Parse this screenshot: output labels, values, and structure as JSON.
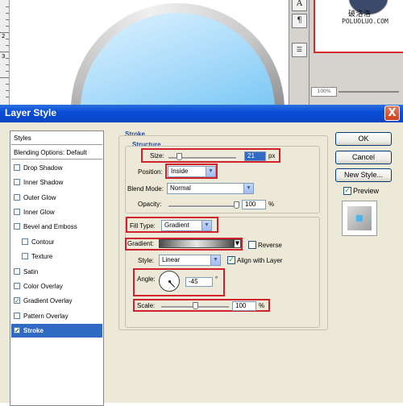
{
  "background": {
    "ruler_numbers": [
      "2",
      "3"
    ],
    "tool_icons": [
      "text-tool-icon",
      "paragraph-icon",
      "panel-menu-icon"
    ],
    "tool_glyphs": [
      "A",
      "¶",
      "☰"
    ],
    "navigator": {
      "logo_text": "破洛洛",
      "url_text": "POLUOLUO.COM",
      "zoom": "100%"
    }
  },
  "dialog": {
    "title": "Layer Style",
    "close_label": "X",
    "styles_list": [
      {
        "label": "Styles",
        "checkbox": false,
        "checked": false,
        "header": true
      },
      {
        "label": "Blending Options: Default",
        "checkbox": false,
        "checked": false,
        "header": true
      },
      {
        "label": "Drop Shadow",
        "checkbox": true,
        "checked": false
      },
      {
        "label": "Inner Shadow",
        "checkbox": true,
        "checked": false
      },
      {
        "label": "Outer Glow",
        "checkbox": true,
        "checked": false
      },
      {
        "label": "Inner Glow",
        "checkbox": true,
        "checked": false
      },
      {
        "label": "Bevel and Emboss",
        "checkbox": true,
        "checked": false
      },
      {
        "label": "Contour",
        "checkbox": true,
        "checked": false,
        "indent": true
      },
      {
        "label": "Texture",
        "checkbox": true,
        "checked": false,
        "indent": true
      },
      {
        "label": "Satin",
        "checkbox": true,
        "checked": false
      },
      {
        "label": "Color Overlay",
        "checkbox": true,
        "checked": false
      },
      {
        "label": "Gradient Overlay",
        "checkbox": true,
        "checked": true
      },
      {
        "label": "Pattern Overlay",
        "checkbox": true,
        "checked": false
      },
      {
        "label": "Stroke",
        "checkbox": true,
        "checked": true,
        "selected": true
      }
    ],
    "stroke": {
      "section_title": "Stroke",
      "structure_title": "Structure",
      "size_label": "Size:",
      "size_value": "21",
      "size_unit": "px",
      "size_slider_fraction": 0.15,
      "position_label": "Position:",
      "position_value": "Inside",
      "blend_mode_label": "Blend Mode:",
      "blend_mode_value": "Normal",
      "opacity_label": "Opacity:",
      "opacity_value": "100",
      "opacity_unit": "%",
      "opacity_slider_fraction": 1.0,
      "fill_type_label": "Fill Type:",
      "fill_type_value": "Gradient",
      "gradient_label": "Gradient:",
      "reverse_label": "Reverse",
      "reverse_checked": false,
      "style_label": "Style:",
      "style_value": "Linear",
      "align_label": "Align with Layer",
      "align_checked": true,
      "angle_label": "Angle:",
      "angle_value": "-45",
      "angle_unit": "°",
      "scale_label": "Scale:",
      "scale_value": "100",
      "scale_unit": "%",
      "scale_slider_fraction": 0.5
    },
    "buttons": {
      "ok": "OK",
      "cancel": "Cancel",
      "new_style": "New Style...",
      "preview_label": "Preview",
      "preview_checked": true
    },
    "colors": {
      "titlebar": "#0a4ed6",
      "selection": "#316ac5",
      "highlight_box": "#d1222b"
    }
  }
}
